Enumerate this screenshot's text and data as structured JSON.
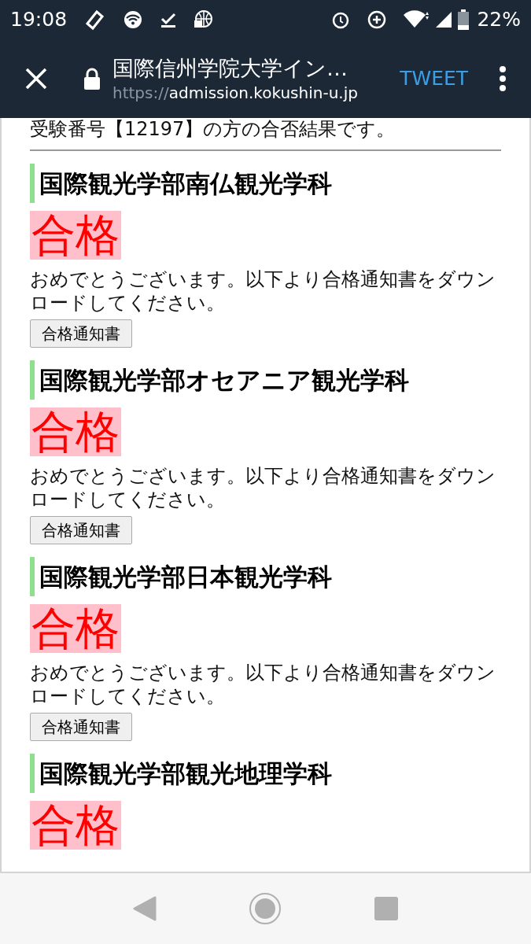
{
  "status_bar": {
    "time": "19:08",
    "battery": "22%"
  },
  "toolbar": {
    "title": "国際信州学院大学イン…",
    "url_scheme": "https://",
    "url_host": "admission.kokushin-u.jp",
    "action": "TWEET"
  },
  "intro": "受験番号【12197】の方の合否結果です。",
  "results": [
    {
      "department": "国際観光学部南仏観光学科",
      "result": "合格",
      "message": "おめでとうございます。以下より合格通知書をダウンロードしてください。",
      "button": "合格通知書"
    },
    {
      "department": "国際観光学部オセアニア観光学科",
      "result": "合格",
      "message": "おめでとうございます。以下より合格通知書をダウンロードしてください。",
      "button": "合格通知書"
    },
    {
      "department": "国際観光学部日本観光学科",
      "result": "合格",
      "message": "おめでとうございます。以下より合格通知書をダウンロードしてください。",
      "button": "合格通知書"
    },
    {
      "department": "国際観光学部観光地理学科",
      "result": "合格"
    }
  ]
}
